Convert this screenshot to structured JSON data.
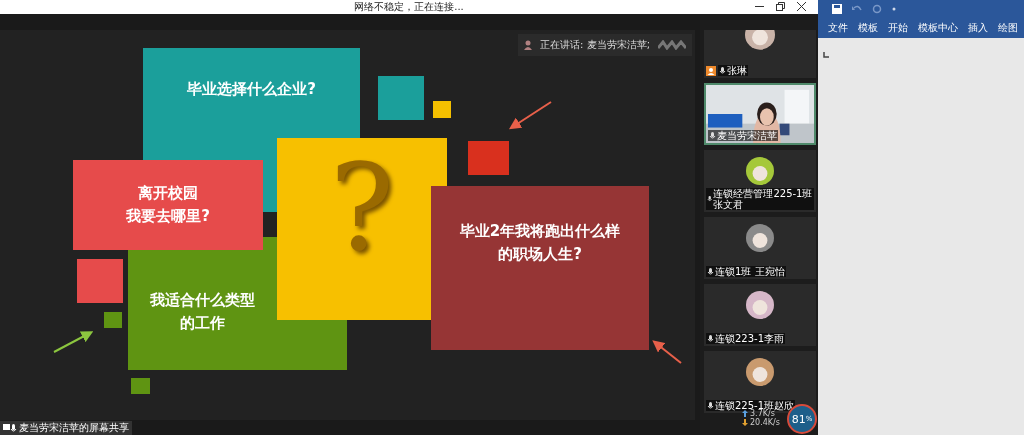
{
  "window": {
    "title": "网络不稳定，正在连接..."
  },
  "speaking": {
    "text": "正在讲话: 麦当劳宋洁苹;"
  },
  "slide": {
    "shapes": [
      {
        "kind": "text-box",
        "color": "#1b9f9b",
        "lines": [
          "毕业选择什么企业?"
        ]
      },
      {
        "kind": "box",
        "color": "#1b9f9b"
      },
      {
        "kind": "box",
        "color": "#f5c000"
      },
      {
        "kind": "box",
        "color": "#d9301e"
      },
      {
        "kind": "text-box",
        "color": "#e64b4b",
        "lines": [
          "离开校园",
          "我要去哪里?"
        ]
      },
      {
        "kind": "text-box",
        "color": "#5f9412",
        "lines": [
          "我适合什么类型",
          "的工作"
        ]
      },
      {
        "kind": "question",
        "color": "#f7c000",
        "lines": [
          "?"
        ]
      },
      {
        "kind": "box",
        "color": "#e64b4b"
      },
      {
        "kind": "box",
        "color": "#5f9412"
      },
      {
        "kind": "box",
        "color": "#5f9412"
      },
      {
        "kind": "text-box",
        "color": "#963535",
        "lines": [
          "毕业2年我将跑出什么样",
          "的职场人生?"
        ]
      },
      {
        "kind": "arrow",
        "color": "#e8604a"
      },
      {
        "kind": "arrow",
        "color": "#e8604a"
      },
      {
        "kind": "arrow",
        "color": "#8cc63f"
      }
    ]
  },
  "share_label": "麦当劳宋洁苹的屏幕共享",
  "participants": [
    {
      "name": "张琳",
      "kind": "avatar",
      "host": true,
      "active": false
    },
    {
      "name": "麦当劳宋洁苹",
      "kind": "video",
      "host": false,
      "active": true
    },
    {
      "name": "连锁经营管理225-1班张文君",
      "kind": "avatar",
      "host": false,
      "active": false
    },
    {
      "name": "连锁1班 王宛怡",
      "kind": "avatar",
      "host": false,
      "active": false
    },
    {
      "name": "连锁223-1李雨",
      "kind": "avatar",
      "host": false,
      "active": false
    },
    {
      "name": "连锁225-1班赵欣",
      "kind": "avatar",
      "host": false,
      "active": false
    }
  ],
  "network": {
    "upload": "3.7K/s",
    "download": "20.4K/s",
    "percent": "81",
    "unit": "%"
  },
  "editor": {
    "tabs": [
      {
        "label": "文件",
        "selected": false
      },
      {
        "label": "模板",
        "selected": false
      },
      {
        "label": "开始",
        "selected": false
      },
      {
        "label": "模板中心",
        "selected": false
      },
      {
        "label": "插入",
        "selected": false
      },
      {
        "label": "绘图",
        "selected": false
      }
    ]
  }
}
